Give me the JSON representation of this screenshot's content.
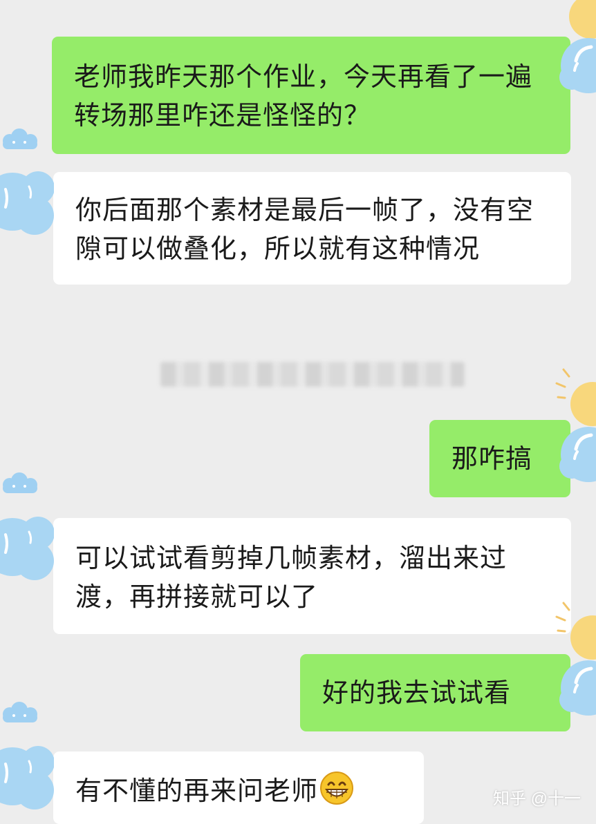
{
  "colors": {
    "background": "#ededed",
    "sent_bubble": "#95ec69",
    "received_bubble": "#ffffff",
    "text": "#1a1a1a"
  },
  "messages": [
    {
      "sender": "self",
      "text": "老师我昨天那个作业，今天再看了一遍转场那里咋还是怪怪的？"
    },
    {
      "sender": "other",
      "text": "你后面那个素材是最后一帧了，没有空隙可以做叠化，所以就有这种情况"
    },
    {
      "sender": "self",
      "text": "那咋搞"
    },
    {
      "sender": "other",
      "text": "可以试试看剪掉几帧素材，溜出来过渡，再拼接就可以了"
    },
    {
      "sender": "self",
      "text": "好的我去试试看"
    },
    {
      "sender": "other",
      "text": "有不懂的再来问老师",
      "emoji": "grinning-face-emoji"
    }
  ],
  "watermark": "知乎 @十一"
}
